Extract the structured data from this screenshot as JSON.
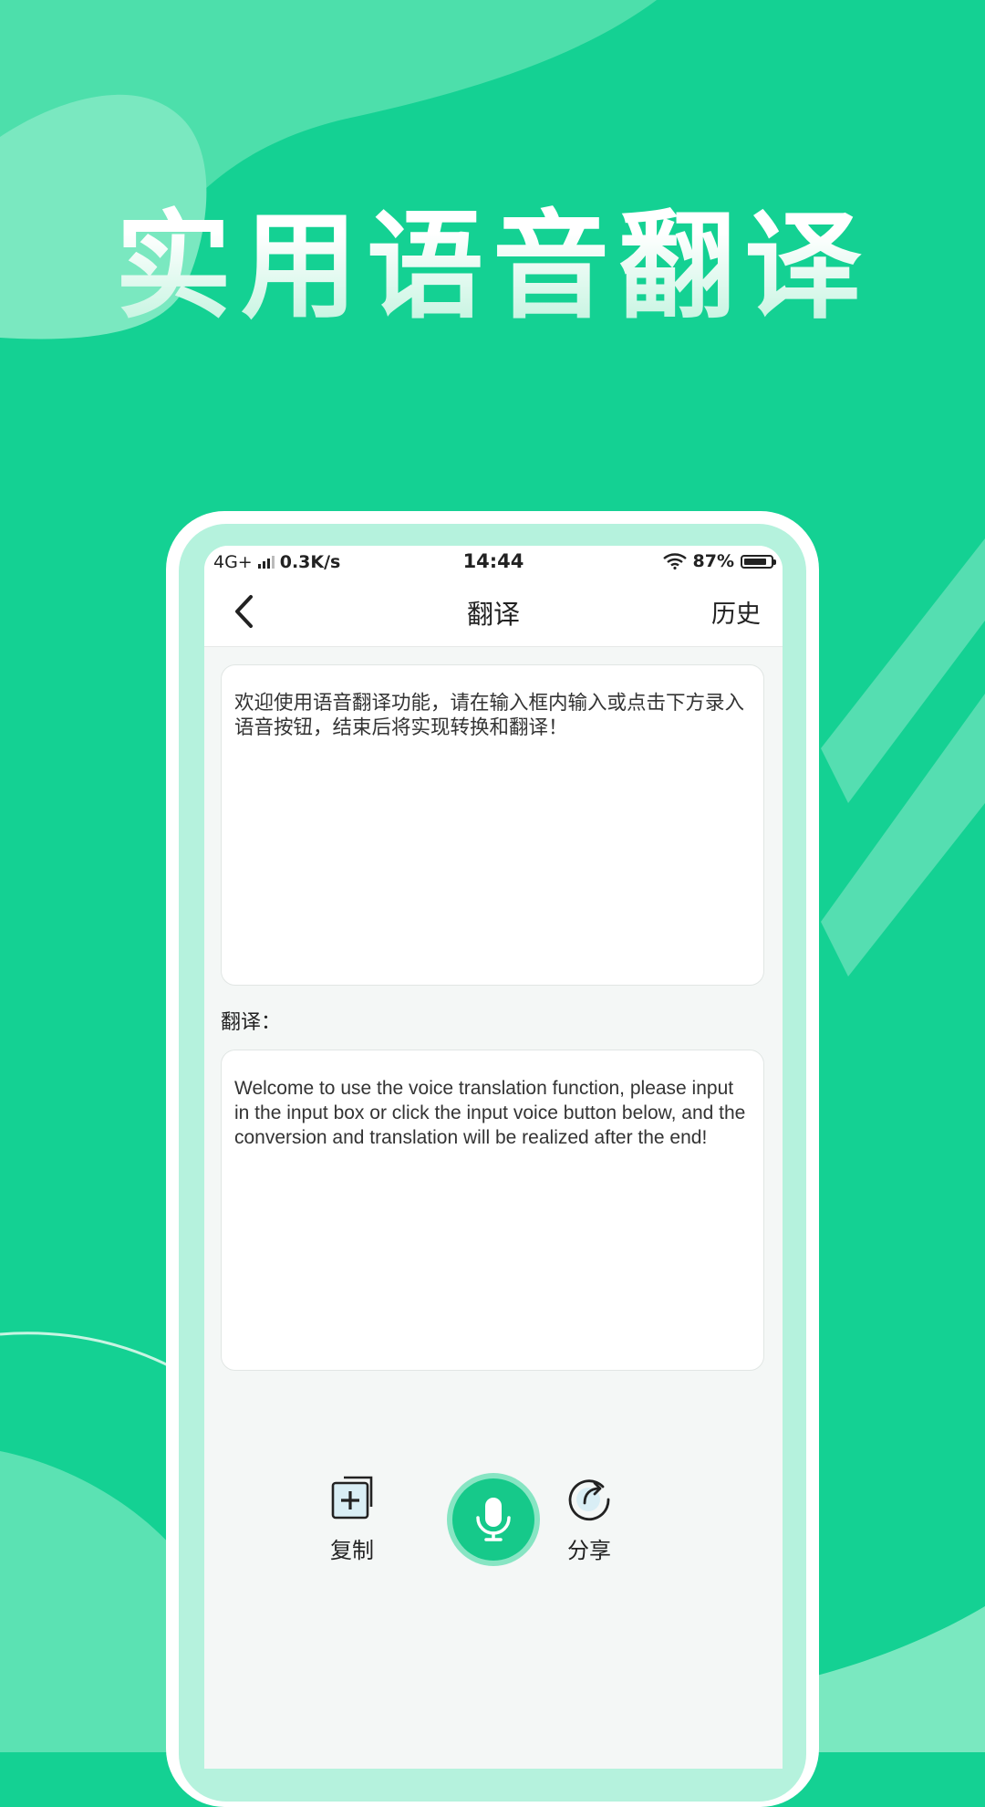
{
  "headline": "实用语音翻译",
  "status_bar": {
    "network": "4G+",
    "speed": "0.3K/s",
    "time": "14:44",
    "battery": "87%",
    "battery_level": 0.87
  },
  "navbar": {
    "title": "翻译",
    "history_label": "历史"
  },
  "input_box": {
    "text": "欢迎使用语音翻译功能，请在输入框内输入或点击下方录入语音按钮，结束后将实现转换和翻译！"
  },
  "translation_label": "翻译：",
  "output_box": {
    "text": "Welcome to use the voice translation function, please input in the input box or click the input voice button below, and the conversion and translation will be realized after the end!"
  },
  "actions": {
    "copy_label": "复制",
    "share_label": "分享"
  },
  "colors": {
    "background": "#14d193",
    "accent": "#16c98a",
    "phone_frame": "#b5f2dd"
  }
}
